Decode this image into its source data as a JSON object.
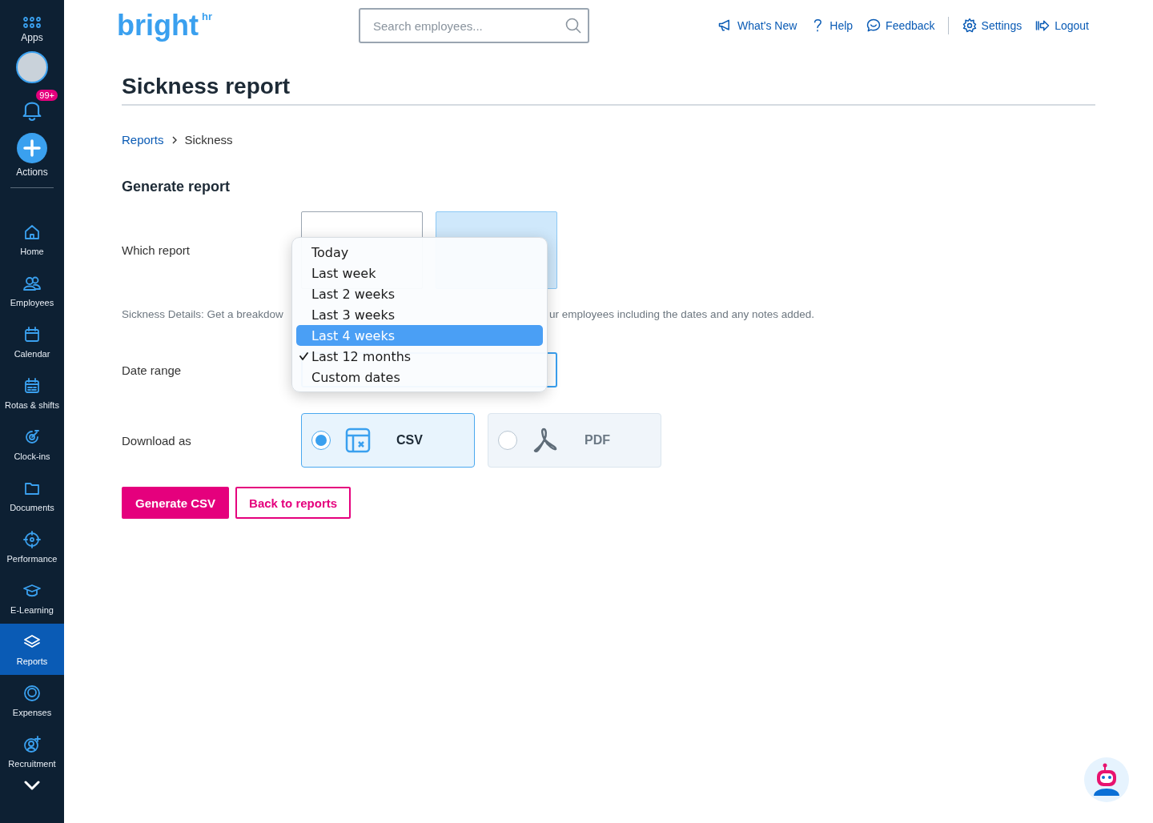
{
  "sidebar": {
    "apps_label": "Apps",
    "notification_badge": "99+",
    "actions_label": "Actions",
    "items": [
      {
        "label": "Home",
        "kind": "home",
        "selected": false
      },
      {
        "label": "Employees",
        "kind": "people",
        "selected": false
      },
      {
        "label": "Calendar",
        "kind": "calendar",
        "selected": false
      },
      {
        "label": "Rotas & shifts",
        "kind": "rota",
        "selected": false
      },
      {
        "label": "Clock-ins",
        "kind": "clock",
        "selected": false
      },
      {
        "label": "Documents",
        "kind": "folder",
        "selected": false
      },
      {
        "label": "Performance",
        "kind": "target",
        "selected": false
      },
      {
        "label": "E-Learning",
        "kind": "cap",
        "selected": false
      },
      {
        "label": "Reports",
        "kind": "layers",
        "selected": true
      },
      {
        "label": "Expenses",
        "kind": "coin",
        "selected": false
      },
      {
        "label": "Recruitment",
        "kind": "person",
        "selected": false
      }
    ]
  },
  "header": {
    "logo": "bright",
    "logo_sup": "hr",
    "search": {
      "placeholder": "Search employees..."
    },
    "links": [
      {
        "label": "What's New",
        "kind": "megaphone"
      },
      {
        "label": "Help",
        "kind": "question"
      },
      {
        "label": "Feedback",
        "kind": "chat"
      },
      {
        "label": "Settings",
        "kind": "gear"
      },
      {
        "label": "Logout",
        "kind": "logout"
      }
    ]
  },
  "page": {
    "title": "Sickness report",
    "breadcrumb": [
      "Reports",
      "Sickness"
    ],
    "section_title": "Generate report",
    "which_report_label": "Which report",
    "report_cards": [
      {
        "selected": false
      },
      {
        "selected": true
      }
    ],
    "description_start": "Sickness Details: Get a breakdow",
    "description_end": "ur employees including the dates and any notes added.",
    "date_range_label": "Date range",
    "date_range_menu": [
      {
        "label": "Today",
        "checked": false,
        "highlighted": false
      },
      {
        "label": "Last week",
        "checked": false,
        "highlighted": false
      },
      {
        "label": "Last 2 weeks",
        "checked": false,
        "highlighted": false
      },
      {
        "label": "Last 3 weeks",
        "checked": false,
        "highlighted": false
      },
      {
        "label": "Last 4 weeks",
        "checked": false,
        "highlighted": true
      },
      {
        "label": "Last 12 months",
        "checked": true,
        "highlighted": false
      },
      {
        "label": "Custom dates",
        "checked": false,
        "highlighted": false
      }
    ],
    "download_label": "Download as",
    "download_options": [
      {
        "label": "CSV",
        "kind": "csv",
        "selected": true
      },
      {
        "label": "PDF",
        "kind": "pdf",
        "selected": false
      }
    ],
    "buttons": [
      {
        "label": "Generate CSV",
        "kind": "primary"
      },
      {
        "label": "Back to reports",
        "kind": "secondary"
      }
    ]
  }
}
